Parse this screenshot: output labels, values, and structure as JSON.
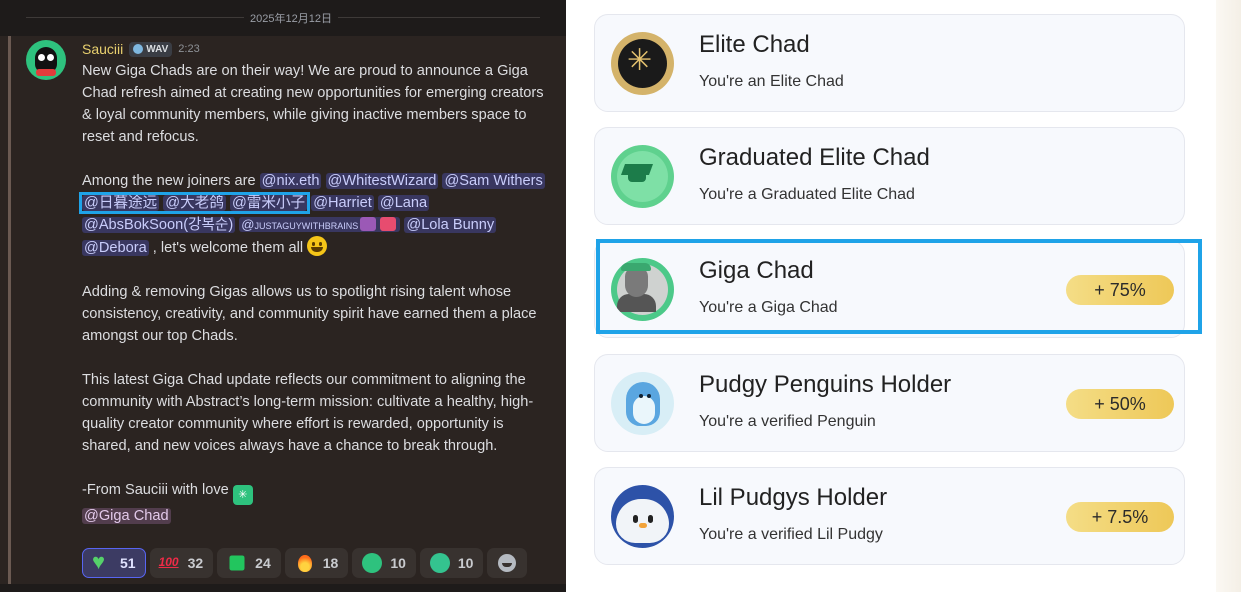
{
  "chat": {
    "date_divider": "2025年12月12日",
    "author": {
      "name": "Sauciii",
      "tag": "WAV",
      "time": "2:23",
      "name_color": "#e8d06e"
    },
    "announcement": "New Giga Chads are on their way! We are proud to announce a Giga Chad refresh aimed at creating new opportunities for emerging creators & loyal community members, while giving inactive members space to reset and refocus.",
    "joiners_intro": "Among the new joiners are ",
    "mentions": {
      "nix": "@nix.eth",
      "whitest": "@WhitestWizard",
      "sam": "@Sam Withers",
      "riri": "@日暮途远",
      "dalao": "@大老鸽",
      "leimi": "@雷米小子",
      "harriet": "@Harriet",
      "lana": "@Lana",
      "abs": "@AbsBokSoon(강복순)",
      "justa": "@justaguywithbrains",
      "lola": "@Lola Bunny",
      "debora": "@Debora",
      "giga_role": "@Giga Chad"
    },
    "welcome_text": " , let's welcome them all ",
    "adding_paragraph": "Adding & removing Gigas allows us to spotlight rising talent whose consistency, creativity, and community spirit have earned them a place amongst our top Chads.",
    "update_paragraph": "This latest Giga Chad update reflects our commitment to aligning the community with Abstract’s long-term mission: cultivate a healthy, high-quality creator community where effort is rewarded, opportunity is shared, and new voices always have a chance to break through.",
    "signoff": "-From Sauciii with love ",
    "reactions": [
      {
        "icon": "green-heart-icon",
        "count": "51",
        "active": true
      },
      {
        "icon": "hundred-points-icon",
        "count": "32"
      },
      {
        "icon": "green-gem-icon",
        "count": "24"
      },
      {
        "icon": "fire-icon",
        "count": "18"
      },
      {
        "icon": "penguin-emoji-icon",
        "count": "10"
      },
      {
        "icon": "penguin-wave-icon",
        "count": "10"
      }
    ],
    "highlight_color": "#1fa3e8"
  },
  "roles": [
    {
      "title": "Elite Chad",
      "subtitle": "You're an Elite Chad",
      "bonus": "",
      "icon": "elite-chad-icon"
    },
    {
      "title": "Graduated Elite Chad",
      "subtitle": "You're a Graduated Elite Chad",
      "bonus": "",
      "icon": "graduation-cap-icon"
    },
    {
      "title": "Giga Chad",
      "subtitle": "You're a Giga Chad",
      "bonus": "+ 75%",
      "icon": "giga-chad-icon",
      "highlighted": true
    },
    {
      "title": "Pudgy Penguins Holder",
      "subtitle": "You're a verified Penguin",
      "bonus": "+ 50%",
      "icon": "pudgy-penguin-icon"
    },
    {
      "title": "Lil Pudgys Holder",
      "subtitle": "You're a verified Lil Pudgy",
      "bonus": "+ 7.5%",
      "icon": "lil-pudgy-icon"
    }
  ]
}
